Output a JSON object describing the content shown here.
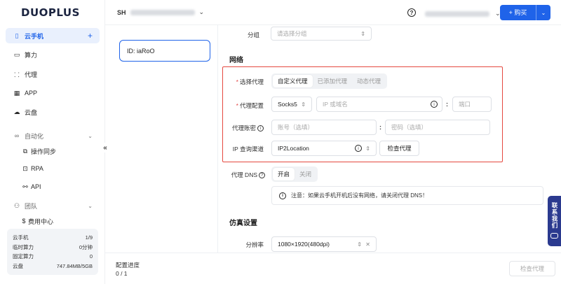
{
  "brand": {
    "logo_text": "DUOPLUS"
  },
  "sidebar": {
    "items": [
      {
        "label": "云手机",
        "icon": "phone-icon"
      },
      {
        "label": "算力",
        "icon": "monitor-icon"
      },
      {
        "label": "代理",
        "icon": "network-icon"
      },
      {
        "label": "APP",
        "icon": "grid-icon"
      },
      {
        "label": "云盘",
        "icon": "cloud-icon"
      }
    ],
    "automation_group": "自动化",
    "automation_items": [
      {
        "label": "操作同步",
        "icon": "sync-icon"
      },
      {
        "label": "RPA",
        "icon": "robot-icon"
      },
      {
        "label": "API",
        "icon": "api-icon"
      }
    ],
    "team_group": "团队",
    "billing": {
      "label": "费用中心",
      "icon": "dollar-icon"
    },
    "stats": [
      {
        "label": "云手机",
        "value": "1/9"
      },
      {
        "label": "临时算力",
        "value": "0分钟"
      },
      {
        "label": "固定算力",
        "value": "0"
      },
      {
        "label": "云盘",
        "value": "747.84MB/5GB"
      }
    ]
  },
  "header": {
    "project_code": "SH",
    "buy_label": "购买",
    "buy_prefix": "+"
  },
  "device": {
    "id_label": "ID: iaRoO"
  },
  "form": {
    "group_label": "分组",
    "group_placeholder": "请选择分组",
    "network_title": "网络",
    "proxy_select_label": "选择代理",
    "proxy_tabs": [
      "自定义代理",
      "已添加代理",
      "动态代理"
    ],
    "proxy_config_label": "代理配置",
    "protocol_value": "Socks5",
    "host_placeholder": "IP 或域名",
    "port_placeholder": "端口",
    "account_label": "代理账密",
    "username_placeholder": "账号（选填）",
    "password_placeholder": "密码（选填）",
    "ip_channel_label": "IP 查询渠道",
    "ip_channel_value": "IP2Location",
    "check_proxy_button": "检查代理",
    "dns_label": "代理 DNS",
    "dns_options": [
      "开启",
      "关闭"
    ],
    "dns_notice": "注意：如果云手机开机后没有网络，请关闭代理 DNS！",
    "sim_title": "仿真设置",
    "resolution_label": "分辨率",
    "resolution_value": "1080×1920(480dpi)"
  },
  "footer": {
    "progress_label": "配置进度",
    "progress_value": "0 / 1",
    "check_button": "检查代理"
  },
  "contact": {
    "label": "联系我们"
  },
  "colors": {
    "accent": "#1f63e9",
    "highlight_border": "#e5483f",
    "required": "#e24b4b"
  }
}
